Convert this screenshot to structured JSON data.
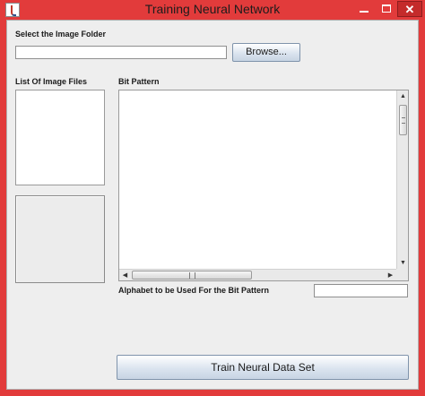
{
  "window": {
    "title": "Training Neural Network",
    "minimize_icon": "minimize-icon",
    "maximize_icon": "maximize-icon",
    "close_icon": "close-icon",
    "close_label": "✕"
  },
  "folder": {
    "label": "Select the Image Folder",
    "value": "",
    "browse_label": "Browse..."
  },
  "image_list": {
    "label": "List Of Image Files",
    "items": []
  },
  "bit_pattern": {
    "label": "Bit Pattern",
    "value": ""
  },
  "alphabet": {
    "label": "Alphabet to be Used For the Bit Pattern",
    "value": ""
  },
  "train_button": {
    "label": "Train Neural Data Set"
  },
  "scroll_arrows": {
    "up": "▲",
    "down": "▼",
    "left": "◀",
    "right": "▶"
  },
  "colors": {
    "title_bar": "#e23b3b",
    "close_button": "#c42b2b",
    "client_background": "#eeeeee",
    "button_gradient_end": "#c7d4e3"
  }
}
